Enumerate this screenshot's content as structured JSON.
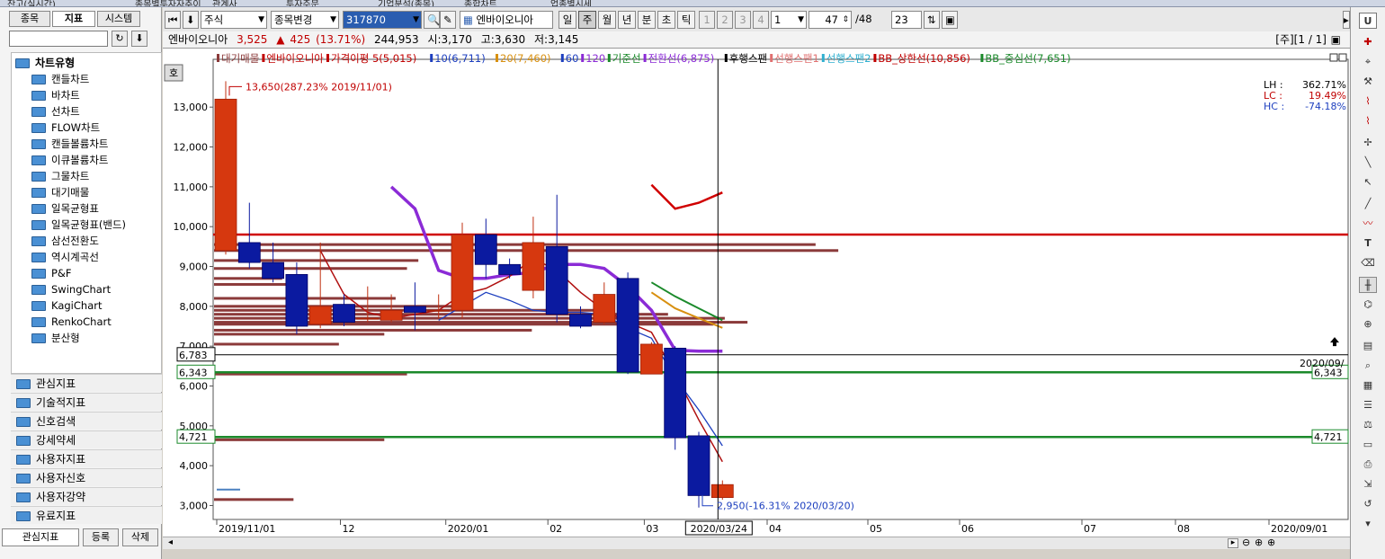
{
  "top_tabs": [
    "잔고(실시간)",
    "종목별투자자추이",
    "관계사",
    "투자주문",
    "기업분석(종목)",
    "종합차트",
    "업종별시세"
  ],
  "left_panel": {
    "tabs": [
      "종목",
      "지표",
      "시스템"
    ],
    "active_tab": "지표",
    "tree_title": "차트유형",
    "chart_types": [
      "캔들차트",
      "바차트",
      "선차트",
      "FLOW차트",
      "캔들볼륨차트",
      "이큐볼륨차트",
      "그물차트",
      "대기매물",
      "일목균형표",
      "일목균형표(밴드)",
      "삼선전환도",
      "역시계곡선",
      "P&F",
      "SwingChart",
      "KagiChart",
      "RenkoChart",
      "분산형"
    ],
    "categories": [
      "관심지표",
      "기술적지표",
      "신호검색",
      "강세약세",
      "사용자지표",
      "사용자신호",
      "사용자강약",
      "유료지표"
    ],
    "bottom_buttons": [
      "관심지표",
      "등록",
      "삭제"
    ]
  },
  "toolbar": {
    "market_select": "주식",
    "change_button": "종목변경",
    "code": "317870",
    "stock_name": "엔바이오니아",
    "periods": [
      "일",
      "주",
      "월",
      "년",
      "분",
      "초",
      "틱"
    ],
    "active_period": "주",
    "numbers": [
      "1",
      "2",
      "3",
      "4"
    ],
    "number_select": "1",
    "count_value": "47",
    "count_total": "/48",
    "display_count": "23"
  },
  "infobar": {
    "name": "엔바이오니아",
    "price": "3,525",
    "change_arrow": "▲",
    "change": "425",
    "change_pct": "(13.71%)",
    "volume": "244,953",
    "open": "시:3,170",
    "high": "고:3,630",
    "low": "저:3,145",
    "page": "[주][1 / 1]"
  },
  "chart": {
    "legend": [
      {
        "label": "대기매물",
        "color": "#8b3a3a"
      },
      {
        "label": "엔바이오니아",
        "color": "#c00000"
      },
      {
        "label": "가격이평 5(5,015)",
        "color": "#c00000"
      },
      {
        "label": "10(6,711)",
        "color": "#1d3fbf"
      },
      {
        "label": "20(7,460)",
        "color": "#d89010"
      },
      {
        "label": "60",
        "color": "#1d3fbf"
      },
      {
        "label": "120",
        "color": "#8b2bd6"
      },
      {
        "label": "기준선",
        "color": "#1b8a2b"
      },
      {
        "label": "전환선(6,875)",
        "color": "#8b2bd6"
      },
      {
        "label": "후행스팬",
        "color": "#000000"
      },
      {
        "label": "선행스팬1",
        "color": "#e07070"
      },
      {
        "label": "선행스팬2",
        "color": "#30b0d0"
      },
      {
        "label": "BB_상한선(10,856)",
        "color": "#c00000"
      },
      {
        "label": "BB_중심선(7,651)",
        "color": "#1b8a2b"
      }
    ],
    "yticks": [
      "13,000",
      "12,000",
      "11,000",
      "10,000",
      "9,000",
      "8,000",
      "7,000",
      "6,000",
      "5,000",
      "4,000",
      "3,000"
    ],
    "xticks": [
      "2019/11/01",
      "12",
      "2020/01",
      "02",
      "03",
      "04",
      "05",
      "06",
      "07",
      "08",
      "2020/09/01"
    ],
    "cursor_date": "2020/03/24",
    "high_annotation": "13,650(287.23% 2019/11/01)",
    "low_annotation": "2,950(-16.31% 2020/03/20)",
    "stats": [
      {
        "label": "LH :",
        "value": "362.71%",
        "color": "#000000"
      },
      {
        "label": "LC :",
        "value": "19.49%",
        "color": "#c00000"
      },
      {
        "label": "HC :",
        "value": "-74.18%",
        "color": "#1d3fbf"
      }
    ],
    "price_tags_left": [
      "6,783",
      "6,343",
      "4,721"
    ],
    "price_tags_right": [
      "6,343",
      "4,721"
    ],
    "right_date_label": "2020/09/",
    "left_corner_label": "호"
  },
  "chart_data": {
    "type": "candlestick",
    "period": "weekly",
    "candles": [
      {
        "date": "2019/11/01",
        "o": 9400,
        "h": 13650,
        "l": 9300,
        "c": 13200
      },
      {
        "date": "2019/11/08",
        "o": 9600,
        "h": 10600,
        "l": 8950,
        "c": 9100
      },
      {
        "date": "2019/11/15",
        "o": 9100,
        "h": 9600,
        "l": 8600,
        "c": 8700
      },
      {
        "date": "2019/11/22",
        "o": 8800,
        "h": 9100,
        "l": 7300,
        "c": 7500
      },
      {
        "date": "2019/11/29",
        "o": 7550,
        "h": 9600,
        "l": 7450,
        "c": 8000
      },
      {
        "date": "2019/12/06",
        "o": 8050,
        "h": 8300,
        "l": 7500,
        "c": 7600
      },
      {
        "date": "2019/12/13",
        "o": 7700,
        "h": 8500,
        "l": 7600,
        "c": 7700
      },
      {
        "date": "2019/12/20",
        "o": 7650,
        "h": 8300,
        "l": 7600,
        "c": 7900
      },
      {
        "date": "2019/12/27",
        "o": 8000,
        "h": 8600,
        "l": 7400,
        "c": 7850
      },
      {
        "date": "2020/01/03",
        "o": 7900,
        "h": 8300,
        "l": 7700,
        "c": 7900
      },
      {
        "date": "2020/01/10",
        "o": 7900,
        "h": 10100,
        "l": 7700,
        "c": 9800
      },
      {
        "date": "2020/01/17",
        "o": 9800,
        "h": 10200,
        "l": 8700,
        "c": 9050
      },
      {
        "date": "2020/01/24",
        "o": 9050,
        "h": 9200,
        "l": 8700,
        "c": 8800
      },
      {
        "date": "2020/01/31",
        "o": 8400,
        "h": 10250,
        "l": 8200,
        "c": 9600
      },
      {
        "date": "2020/02/07",
        "o": 9500,
        "h": 10800,
        "l": 7600,
        "c": 7800
      },
      {
        "date": "2020/02/14",
        "o": 7800,
        "h": 8000,
        "l": 7450,
        "c": 7500
      },
      {
        "date": "2020/02/21",
        "o": 7600,
        "h": 8600,
        "l": 7550,
        "c": 8300
      },
      {
        "date": "2020/02/28",
        "o": 8700,
        "h": 8850,
        "l": 6300,
        "c": 6350
      },
      {
        "date": "2020/03/06",
        "o": 6300,
        "h": 7100,
        "l": 6300,
        "c": 7050
      },
      {
        "date": "2020/03/13",
        "o": 6950,
        "h": 7000,
        "l": 4400,
        "c": 4700
      },
      {
        "date": "2020/03/20",
        "o": 4750,
        "h": 4850,
        "l": 2950,
        "c": 3250
      },
      {
        "date": "2020/03/27",
        "o": 3200,
        "h": 3630,
        "l": 3145,
        "c": 3525
      }
    ],
    "horizontal_lines": [
      {
        "value": 9800,
        "color": "#d00000"
      },
      {
        "value": 6783,
        "color": "#000000"
      },
      {
        "value": 6343,
        "color": "#1b8a2b"
      },
      {
        "value": 4721,
        "color": "#1b8a2b"
      }
    ],
    "ma5": [
      null,
      null,
      null,
      null,
      9400,
      8300,
      7850,
      7700,
      7800,
      7900,
      8300,
      8450,
      8750,
      9200,
      8900,
      8350,
      7900,
      7600,
      7350,
      6300,
      5150,
      4100
    ],
    "ma10": [
      null,
      null,
      null,
      null,
      null,
      null,
      null,
      null,
      null,
      7650,
      8000,
      8350,
      8150,
      7900,
      7850,
      7850,
      7800,
      7450,
      7200,
      6200,
      5400,
      4500
    ],
    "ma20": [
      null,
      null,
      null,
      null,
      null,
      null,
      null,
      null,
      null,
      null,
      null,
      null,
      null,
      null,
      null,
      null,
      null,
      null,
      8350,
      7950,
      7700,
      7460
    ],
    "bb_upper": [
      null,
      null,
      null,
      null,
      null,
      null,
      null,
      null,
      null,
      null,
      null,
      null,
      null,
      null,
      null,
      null,
      null,
      null,
      11050,
      10450,
      10600,
      10856
    ],
    "bb_mid": [
      null,
      null,
      null,
      null,
      null,
      null,
      null,
      null,
      null,
      null,
      null,
      null,
      null,
      null,
      null,
      null,
      null,
      null,
      8600,
      8250,
      7950,
      7651
    ],
    "conversion": [
      null,
      null,
      null,
      null,
      null,
      null,
      null,
      11000,
      10450,
      8900,
      8700,
      8700,
      8800,
      8850,
      9050,
      9050,
      8950,
      8500,
      7900,
      6900,
      6875,
      6875
    ],
    "volume_profile": [
      {
        "price": 9550,
        "len": 0.53
      },
      {
        "price": 9400,
        "len": 0.55
      },
      {
        "price": 9150,
        "len": 0.18
      },
      {
        "price": 8950,
        "len": 0.17
      },
      {
        "price": 8700,
        "len": 0.06
      },
      {
        "price": 8550,
        "len": 0.07
      },
      {
        "price": 8200,
        "len": 0.16
      },
      {
        "price": 8000,
        "len": 0.22
      },
      {
        "price": 7900,
        "len": 0.34
      },
      {
        "price": 7800,
        "len": 0.4
      },
      {
        "price": 7700,
        "len": 0.45
      },
      {
        "price": 7600,
        "len": 0.47
      },
      {
        "price": 7550,
        "len": 0.44
      },
      {
        "price": 7400,
        "len": 0.28
      },
      {
        "price": 7300,
        "len": 0.15
      },
      {
        "price": 7050,
        "len": 0.11
      },
      {
        "price": 6300,
        "len": 0.17
      },
      {
        "price": 4650,
        "len": 0.15
      },
      {
        "price": 3150,
        "len": 0.07
      }
    ],
    "ylim": [
      2650,
      14200
    ]
  }
}
